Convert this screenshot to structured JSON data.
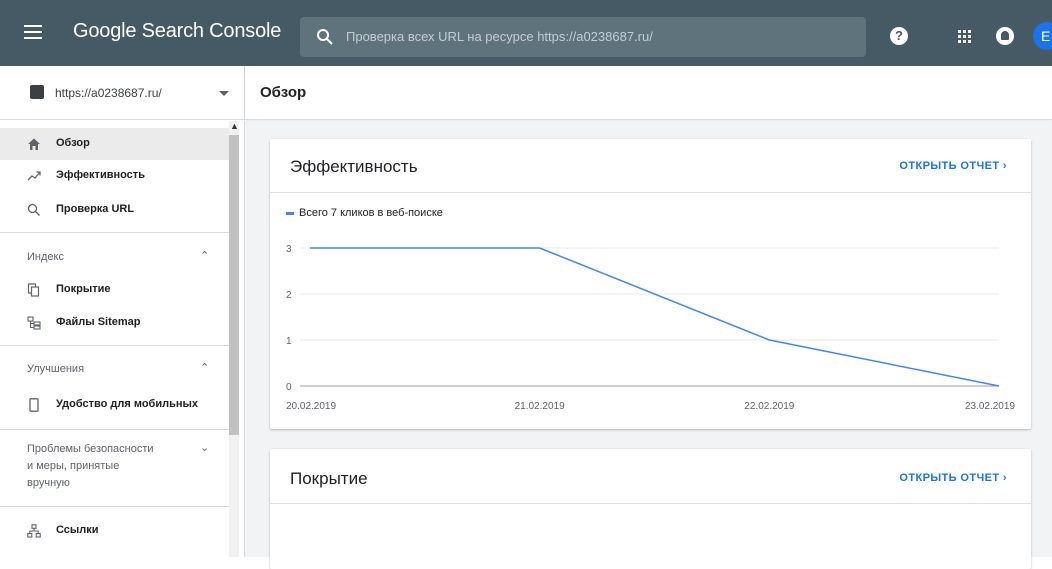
{
  "app": {
    "title": "Google Search Console",
    "search_placeholder": "Проверка всех URL на ресурсе https://a0238687.ru/",
    "help_glyph": "?",
    "avatar_letter": "E"
  },
  "property": {
    "url": "https://a0238687.ru/"
  },
  "page": {
    "title": "Обзор"
  },
  "sidebar": {
    "top_items": [
      {
        "label": "Обзор",
        "icon": "home-icon",
        "active": true
      },
      {
        "label": "Эффективность",
        "icon": "trending-up-icon",
        "active": false
      },
      {
        "label": "Проверка URL",
        "icon": "search-icon",
        "active": false
      }
    ],
    "sections": [
      {
        "label": "Индекс",
        "expanded": true,
        "items": [
          {
            "label": "Покрытие",
            "icon": "copy-icon"
          },
          {
            "label": "Файлы Sitemap",
            "icon": "sitemap-icon"
          }
        ]
      },
      {
        "label": "Улучшения",
        "expanded": true,
        "items": [
          {
            "label": "Удобство для мобильных",
            "icon": "phone-icon"
          }
        ]
      },
      {
        "label": "Проблемы безопасности и меры, принятые вручную",
        "label_lines": [
          "Проблемы безопасности",
          "и меры, принятые",
          "вручную"
        ],
        "expanded": false,
        "items": []
      }
    ],
    "bottom_items": [
      {
        "label": "Ссылки",
        "icon": "links-icon"
      }
    ]
  },
  "cards": [
    {
      "title": "Эффективность",
      "link": "ОТКРЫТЬ ОТЧЕТ"
    },
    {
      "title": "Покрытие",
      "link": "ОТКРЫТЬ ОТЧЕТ"
    }
  ],
  "colors": {
    "topbar": "#455a64",
    "accent": "#1a73e8",
    "series": "#4285f4"
  },
  "chart_data": {
    "type": "line",
    "x": [
      "20.02.2019",
      "21.02.2019",
      "22.02.2019",
      "23.02.2019"
    ],
    "series": [
      {
        "name": "Всего 7 кликов в веб-поиске",
        "values": [
          3,
          3,
          1,
          0
        ]
      }
    ],
    "yticks": [
      0,
      1,
      2,
      3
    ],
    "ylim": [
      0,
      3
    ],
    "grid": true,
    "legend_placement": "top-left"
  }
}
